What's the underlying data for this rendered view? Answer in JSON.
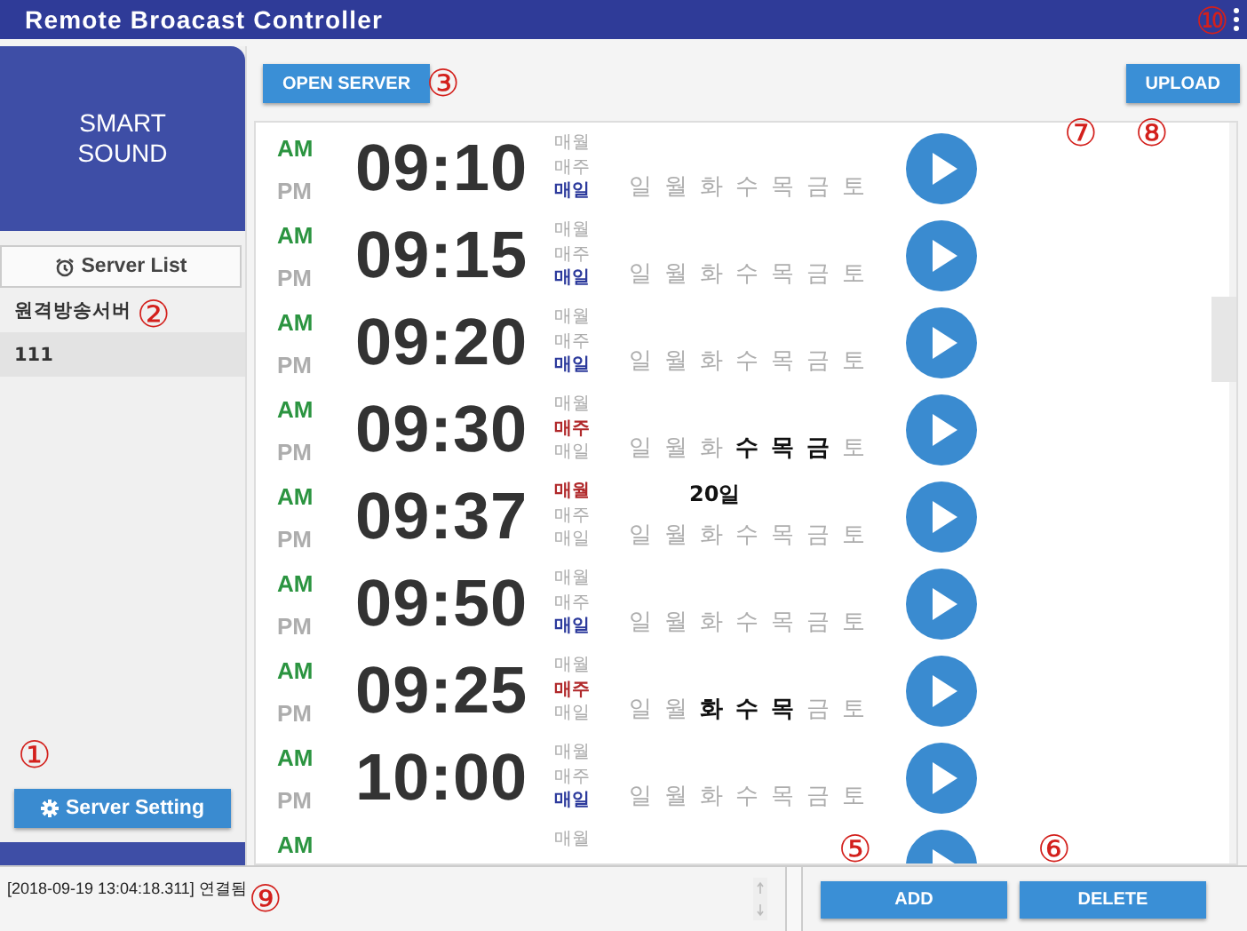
{
  "window": {
    "title": "Remote Broacast Controller"
  },
  "sidebar": {
    "logo": "SMART SOUND",
    "server_list_header": "Server List",
    "servers": [
      {
        "label": "원격방송서버",
        "selected": false
      },
      {
        "label": "111",
        "selected": true
      }
    ],
    "server_setting_button": "Server Setting"
  },
  "toolbar": {
    "open_server_button": "OPEN SERVER",
    "upload_button": "UPLOAD"
  },
  "schedules": [
    {
      "am_pm": [
        {
          "label": "AM",
          "selected": true
        },
        {
          "label": "PM",
          "selected": false
        }
      ],
      "time": "09:10",
      "repeat": [
        {
          "label": "매월",
          "selected": false
        },
        {
          "label": "매주",
          "selected": false
        },
        {
          "label": "매일",
          "selected": true
        }
      ],
      "days": [
        {
          "label": "일",
          "selected": false
        },
        {
          "label": "월",
          "selected": false
        },
        {
          "label": "화",
          "selected": false
        },
        {
          "label": "수",
          "selected": false
        },
        {
          "label": "목",
          "selected": false
        },
        {
          "label": "금",
          "selected": false
        },
        {
          "label": "토",
          "selected": false
        }
      ]
    },
    {
      "am_pm": [
        {
          "label": "AM",
          "selected": true
        },
        {
          "label": "PM",
          "selected": false
        }
      ],
      "time": "09:15",
      "repeat": [
        {
          "label": "매월",
          "selected": false
        },
        {
          "label": "매주",
          "selected": false
        },
        {
          "label": "매일",
          "selected": true
        }
      ],
      "days": [
        {
          "label": "일",
          "selected": false
        },
        {
          "label": "월",
          "selected": false
        },
        {
          "label": "화",
          "selected": false
        },
        {
          "label": "수",
          "selected": false
        },
        {
          "label": "목",
          "selected": false
        },
        {
          "label": "금",
          "selected": false
        },
        {
          "label": "토",
          "selected": false
        }
      ]
    },
    {
      "am_pm": [
        {
          "label": "AM",
          "selected": true
        },
        {
          "label": "PM",
          "selected": false
        }
      ],
      "time": "09:20",
      "repeat": [
        {
          "label": "매월",
          "selected": false
        },
        {
          "label": "매주",
          "selected": false
        },
        {
          "label": "매일",
          "selected": true
        }
      ],
      "days": [
        {
          "label": "일",
          "selected": false
        },
        {
          "label": "월",
          "selected": false
        },
        {
          "label": "화",
          "selected": false
        },
        {
          "label": "수",
          "selected": false
        },
        {
          "label": "목",
          "selected": false
        },
        {
          "label": "금",
          "selected": false
        },
        {
          "label": "토",
          "selected": false
        }
      ]
    },
    {
      "am_pm": [
        {
          "label": "AM",
          "selected": true
        },
        {
          "label": "PM",
          "selected": false
        }
      ],
      "time": "09:30",
      "repeat": [
        {
          "label": "매월",
          "selected": false
        },
        {
          "label": "매주",
          "selected": true
        },
        {
          "label": "매일",
          "selected": false
        }
      ],
      "days": [
        {
          "label": "일",
          "selected": false
        },
        {
          "label": "월",
          "selected": false
        },
        {
          "label": "화",
          "selected": false
        },
        {
          "label": "수",
          "selected": true
        },
        {
          "label": "목",
          "selected": true
        },
        {
          "label": "금",
          "selected": true
        },
        {
          "label": "토",
          "selected": false
        }
      ]
    },
    {
      "am_pm": [
        {
          "label": "AM",
          "selected": true
        },
        {
          "label": "PM",
          "selected": false
        }
      ],
      "time": "09:37",
      "repeat": [
        {
          "label": "매월",
          "selected": true
        },
        {
          "label": "매주",
          "selected": false
        },
        {
          "label": "매일",
          "selected": false
        }
      ],
      "day_of_month": "20일",
      "days": [
        {
          "label": "일",
          "selected": false
        },
        {
          "label": "월",
          "selected": false
        },
        {
          "label": "화",
          "selected": false
        },
        {
          "label": "수",
          "selected": false
        },
        {
          "label": "목",
          "selected": false
        },
        {
          "label": "금",
          "selected": false
        },
        {
          "label": "토",
          "selected": false
        }
      ]
    },
    {
      "am_pm": [
        {
          "label": "AM",
          "selected": true
        },
        {
          "label": "PM",
          "selected": false
        }
      ],
      "time": "09:50",
      "repeat": [
        {
          "label": "매월",
          "selected": false
        },
        {
          "label": "매주",
          "selected": false
        },
        {
          "label": "매일",
          "selected": true
        }
      ],
      "days": [
        {
          "label": "일",
          "selected": false
        },
        {
          "label": "월",
          "selected": false
        },
        {
          "label": "화",
          "selected": false
        },
        {
          "label": "수",
          "selected": false
        },
        {
          "label": "목",
          "selected": false
        },
        {
          "label": "금",
          "selected": false
        },
        {
          "label": "토",
          "selected": false
        }
      ]
    },
    {
      "am_pm": [
        {
          "label": "AM",
          "selected": true
        },
        {
          "label": "PM",
          "selected": false
        }
      ],
      "time": "09:25",
      "repeat": [
        {
          "label": "매월",
          "selected": false
        },
        {
          "label": "매주",
          "selected": true
        },
        {
          "label": "매일",
          "selected": false
        }
      ],
      "days": [
        {
          "label": "일",
          "selected": false
        },
        {
          "label": "월",
          "selected": false
        },
        {
          "label": "화",
          "selected": true
        },
        {
          "label": "수",
          "selected": true
        },
        {
          "label": "목",
          "selected": true
        },
        {
          "label": "금",
          "selected": false
        },
        {
          "label": "토",
          "selected": false
        }
      ]
    },
    {
      "am_pm": [
        {
          "label": "AM",
          "selected": true
        },
        {
          "label": "PM",
          "selected": false
        }
      ],
      "time": "10:00",
      "repeat": [
        {
          "label": "매월",
          "selected": false
        },
        {
          "label": "매주",
          "selected": false
        },
        {
          "label": "매일",
          "selected": true
        }
      ],
      "days": [
        {
          "label": "일",
          "selected": false
        },
        {
          "label": "월",
          "selected": false
        },
        {
          "label": "화",
          "selected": false
        },
        {
          "label": "수",
          "selected": false
        },
        {
          "label": "목",
          "selected": false
        },
        {
          "label": "금",
          "selected": false
        },
        {
          "label": "토",
          "selected": false
        }
      ]
    },
    {
      "am_pm": [
        {
          "label": "AM",
          "selected": true
        }
      ],
      "repeat": [
        {
          "label": "매월",
          "selected": false
        }
      ]
    }
  ],
  "log": {
    "text": "[2018-09-19 13:04:18.311] 연결됨"
  },
  "actions": {
    "add_button": "ADD",
    "delete_button": "DELETE"
  },
  "callouts": [
    "①",
    "②",
    "③",
    "⑤",
    "⑥",
    "⑦",
    "⑧",
    "⑨",
    "⑩"
  ]
}
